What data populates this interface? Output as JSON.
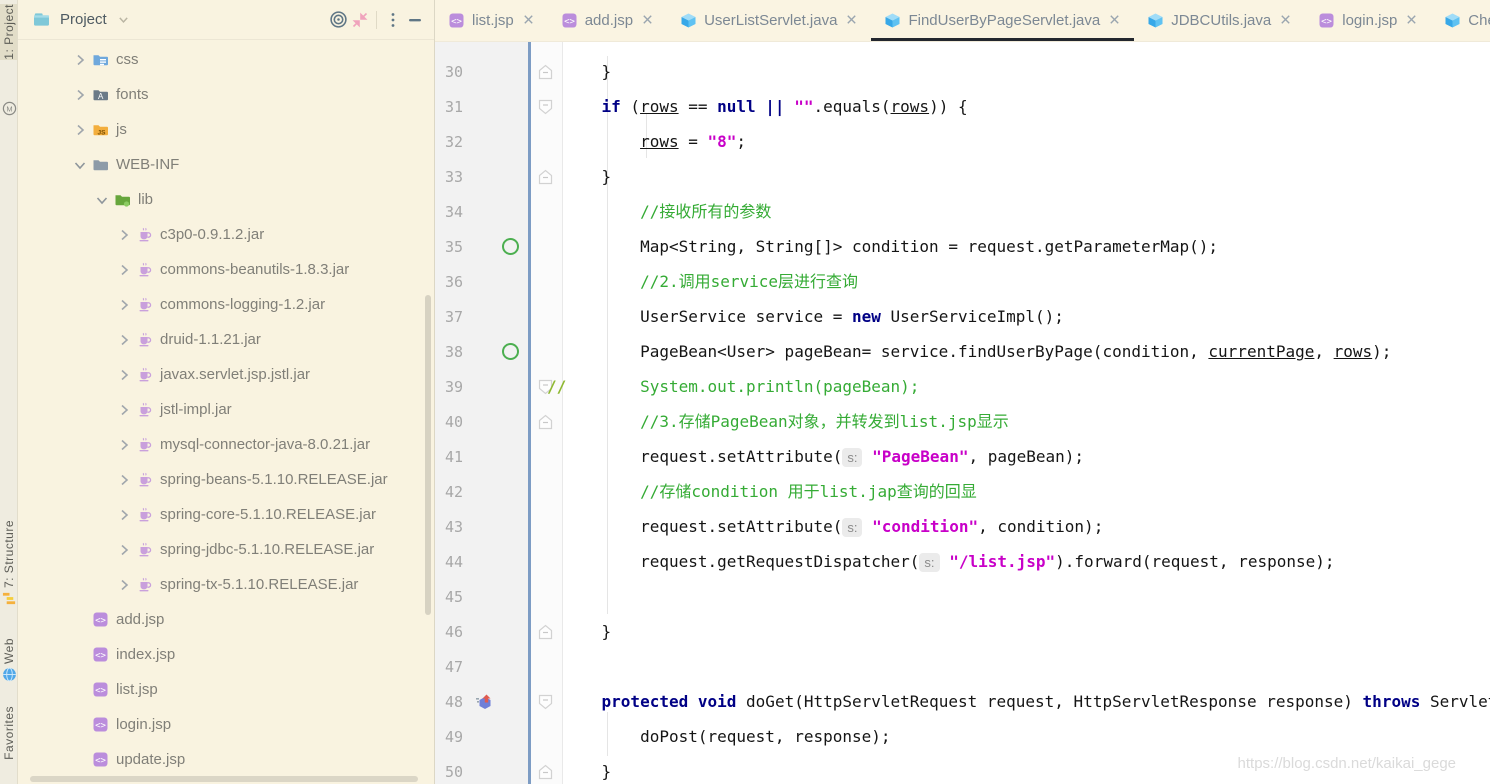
{
  "stripe": {
    "top": [
      {
        "label": "1: Project",
        "icon": "project-window",
        "selected": true
      },
      {
        "label": "",
        "icon": "maven",
        "selected": false
      }
    ],
    "bottom": [
      {
        "label": "7: Structure",
        "icon": "structure",
        "selected": false
      },
      {
        "label": "Web",
        "icon": "web",
        "selected": false
      },
      {
        "label": "Favorites",
        "icon": "none",
        "selected": false
      }
    ]
  },
  "project_panel": {
    "title": "Project",
    "header_icons": [
      "locate",
      "collapse",
      "more",
      "hide"
    ],
    "tree": [
      {
        "label": "css",
        "icon": "folder-css",
        "depth": 1,
        "chevron": "right"
      },
      {
        "label": "fonts",
        "icon": "folder-fonts",
        "depth": 1,
        "chevron": "right"
      },
      {
        "label": "js",
        "icon": "folder-js",
        "depth": 1,
        "chevron": "right"
      },
      {
        "label": "WEB-INF",
        "icon": "folder",
        "depth": 1,
        "chevron": "down"
      },
      {
        "label": "lib",
        "icon": "folder-lib",
        "depth": 2,
        "chevron": "down"
      },
      {
        "label": "c3p0-0.9.1.2.jar",
        "icon": "jar",
        "depth": 3,
        "chevron": "right"
      },
      {
        "label": "commons-beanutils-1.8.3.jar",
        "icon": "jar",
        "depth": 3,
        "chevron": "right"
      },
      {
        "label": "commons-logging-1.2.jar",
        "icon": "jar",
        "depth": 3,
        "chevron": "right"
      },
      {
        "label": "druid-1.1.21.jar",
        "icon": "jar",
        "depth": 3,
        "chevron": "right"
      },
      {
        "label": "javax.servlet.jsp.jstl.jar",
        "icon": "jar",
        "depth": 3,
        "chevron": "right"
      },
      {
        "label": "jstl-impl.jar",
        "icon": "jar",
        "depth": 3,
        "chevron": "right"
      },
      {
        "label": "mysql-connector-java-8.0.21.jar",
        "icon": "jar",
        "depth": 3,
        "chevron": "right"
      },
      {
        "label": "spring-beans-5.1.10.RELEASE.jar",
        "icon": "jar",
        "depth": 3,
        "chevron": "right"
      },
      {
        "label": "spring-core-5.1.10.RELEASE.jar",
        "icon": "jar",
        "depth": 3,
        "chevron": "right"
      },
      {
        "label": "spring-jdbc-5.1.10.RELEASE.jar",
        "icon": "jar",
        "depth": 3,
        "chevron": "right"
      },
      {
        "label": "spring-tx-5.1.10.RELEASE.jar",
        "icon": "jar",
        "depth": 3,
        "chevron": "right"
      },
      {
        "label": "add.jsp",
        "icon": "jsp",
        "depth": 1,
        "chevron": "none"
      },
      {
        "label": "index.jsp",
        "icon": "jsp",
        "depth": 1,
        "chevron": "none"
      },
      {
        "label": "list.jsp",
        "icon": "jsp",
        "depth": 1,
        "chevron": "none"
      },
      {
        "label": "login.jsp",
        "icon": "jsp",
        "depth": 1,
        "chevron": "none"
      },
      {
        "label": "update.jsp",
        "icon": "jsp",
        "depth": 1,
        "chevron": "none"
      }
    ]
  },
  "tabs": [
    {
      "label": "list.jsp",
      "icon": "jsp",
      "active": false,
      "closable": true
    },
    {
      "label": "add.jsp",
      "icon": "jsp",
      "active": false,
      "closable": true
    },
    {
      "label": "UserListServlet.java",
      "icon": "class",
      "active": false,
      "closable": true
    },
    {
      "label": "FindUserByPageServlet.java",
      "icon": "class",
      "active": true,
      "closable": true
    },
    {
      "label": "JDBCUtils.java",
      "icon": "class",
      "active": false,
      "closable": true
    },
    {
      "label": "login.jsp",
      "icon": "jsp",
      "active": false,
      "closable": true
    },
    {
      "label": "Check",
      "icon": "class",
      "active": false,
      "closable": false
    }
  ],
  "editor": {
    "watermark": "https://blog.csdn.net/kaikai_gege",
    "lines": [
      {
        "n": 30,
        "fold": "up",
        "tokens": [
          [
            "p",
            "    }"
          ]
        ]
      },
      {
        "n": 31,
        "fold": "down",
        "tokens": [
          [
            "p",
            "    "
          ],
          [
            "k",
            "if"
          ],
          [
            "p",
            " ("
          ],
          [
            "u",
            "rows"
          ],
          [
            "p",
            " == "
          ],
          [
            "k",
            "null"
          ],
          [
            "p",
            " "
          ],
          [
            "k",
            "||"
          ],
          [
            "p",
            " "
          ],
          [
            "s",
            "\"\""
          ],
          [
            "p",
            ".equals("
          ],
          [
            "u",
            "rows"
          ],
          [
            "p",
            ")) {"
          ]
        ]
      },
      {
        "n": 32,
        "tokens": [
          [
            "p",
            "        "
          ],
          [
            "u",
            "rows"
          ],
          [
            "p",
            " = "
          ],
          [
            "s",
            "\"8\""
          ],
          [
            "p",
            ";"
          ]
        ]
      },
      {
        "n": 33,
        "fold": "up",
        "tokens": [
          [
            "p",
            "    }"
          ]
        ]
      },
      {
        "n": 34,
        "tokens": [
          [
            "p",
            "        "
          ],
          [
            "c",
            "//接收所有的参数"
          ]
        ]
      },
      {
        "n": 35,
        "mark": "circle",
        "tokens": [
          [
            "p",
            "        Map<String, String[]> condition = request.getParameterMap();"
          ]
        ]
      },
      {
        "n": 36,
        "tokens": [
          [
            "p",
            "        "
          ],
          [
            "c",
            "//2.调用service层进行查询"
          ]
        ]
      },
      {
        "n": 37,
        "tokens": [
          [
            "p",
            "        UserService service = "
          ],
          [
            "k",
            "new"
          ],
          [
            "p",
            " UserServiceImpl();"
          ]
        ]
      },
      {
        "n": 38,
        "mark": "circle",
        "tokens": [
          [
            "p",
            "        PageBean<User> pageBean= service.findUserByPage(condition, "
          ],
          [
            "u",
            "currentPage"
          ],
          [
            "p",
            ", "
          ],
          [
            "u",
            "rows"
          ],
          [
            "p",
            ");"
          ]
        ]
      },
      {
        "n": 39,
        "fold": "down",
        "pre": "//",
        "tokens": [
          [
            "c",
            "        System.out.println(pageBean);"
          ]
        ]
      },
      {
        "n": 40,
        "fold": "up",
        "tokens": [
          [
            "p",
            "        "
          ],
          [
            "c",
            "//3.存储PageBean对象，并转发到list.jsp显示"
          ]
        ]
      },
      {
        "n": 41,
        "tokens": [
          [
            "p",
            "        request.setAttribute("
          ],
          [
            "h",
            "s:"
          ],
          [
            "p",
            " "
          ],
          [
            "s",
            "\"PageBean\""
          ],
          [
            "p",
            ", pageBean);"
          ]
        ]
      },
      {
        "n": 42,
        "tokens": [
          [
            "p",
            "        "
          ],
          [
            "c",
            "//存储condition 用于list.jap查询的回显"
          ]
        ]
      },
      {
        "n": 43,
        "tokens": [
          [
            "p",
            "        request.setAttribute("
          ],
          [
            "h",
            "s:"
          ],
          [
            "p",
            " "
          ],
          [
            "s",
            "\"condition\""
          ],
          [
            "p",
            ", condition);"
          ]
        ]
      },
      {
        "n": 44,
        "tokens": [
          [
            "p",
            "        request.getRequestDispatcher("
          ],
          [
            "h",
            "s:"
          ],
          [
            "p",
            " "
          ],
          [
            "s",
            "\"/list.jsp\""
          ],
          [
            "p",
            ").forward(request, response);"
          ]
        ]
      },
      {
        "n": 45,
        "tokens": []
      },
      {
        "n": 46,
        "fold": "up",
        "tokens": [
          [
            "p",
            "    }"
          ]
        ]
      },
      {
        "n": 47,
        "tokens": []
      },
      {
        "n": 48,
        "fold": "down",
        "mark": "override",
        "tokens": [
          [
            "p",
            "    "
          ],
          [
            "k",
            "protected"
          ],
          [
            "p",
            " "
          ],
          [
            "k",
            "void"
          ],
          [
            "p",
            " doGet(HttpServletRequest request, HttpServletResponse response) "
          ],
          [
            "k",
            "throws"
          ],
          [
            "p",
            " ServletExc"
          ]
        ]
      },
      {
        "n": 49,
        "tokens": [
          [
            "p",
            "        doPost(request, response);"
          ]
        ]
      },
      {
        "n": 50,
        "fold": "up",
        "tokens": [
          [
            "p",
            "    }"
          ]
        ]
      }
    ]
  },
  "colors": {
    "panel_bg": "#F9F3E0",
    "stripe_bg": "#EFECE0",
    "tab_bg": "#FAF4E2",
    "active_tab_underline": "#23272E",
    "gutter_bg": "#F2F2F2",
    "gutter_accent_line": "#7D9CC4",
    "keyword": "#000085",
    "string": "#C800C8",
    "comment": "#35AB35",
    "coverage_circle": "#4CAF50",
    "jsp_icon": "#BB8DDC",
    "class_icon": "#47B1EC"
  }
}
